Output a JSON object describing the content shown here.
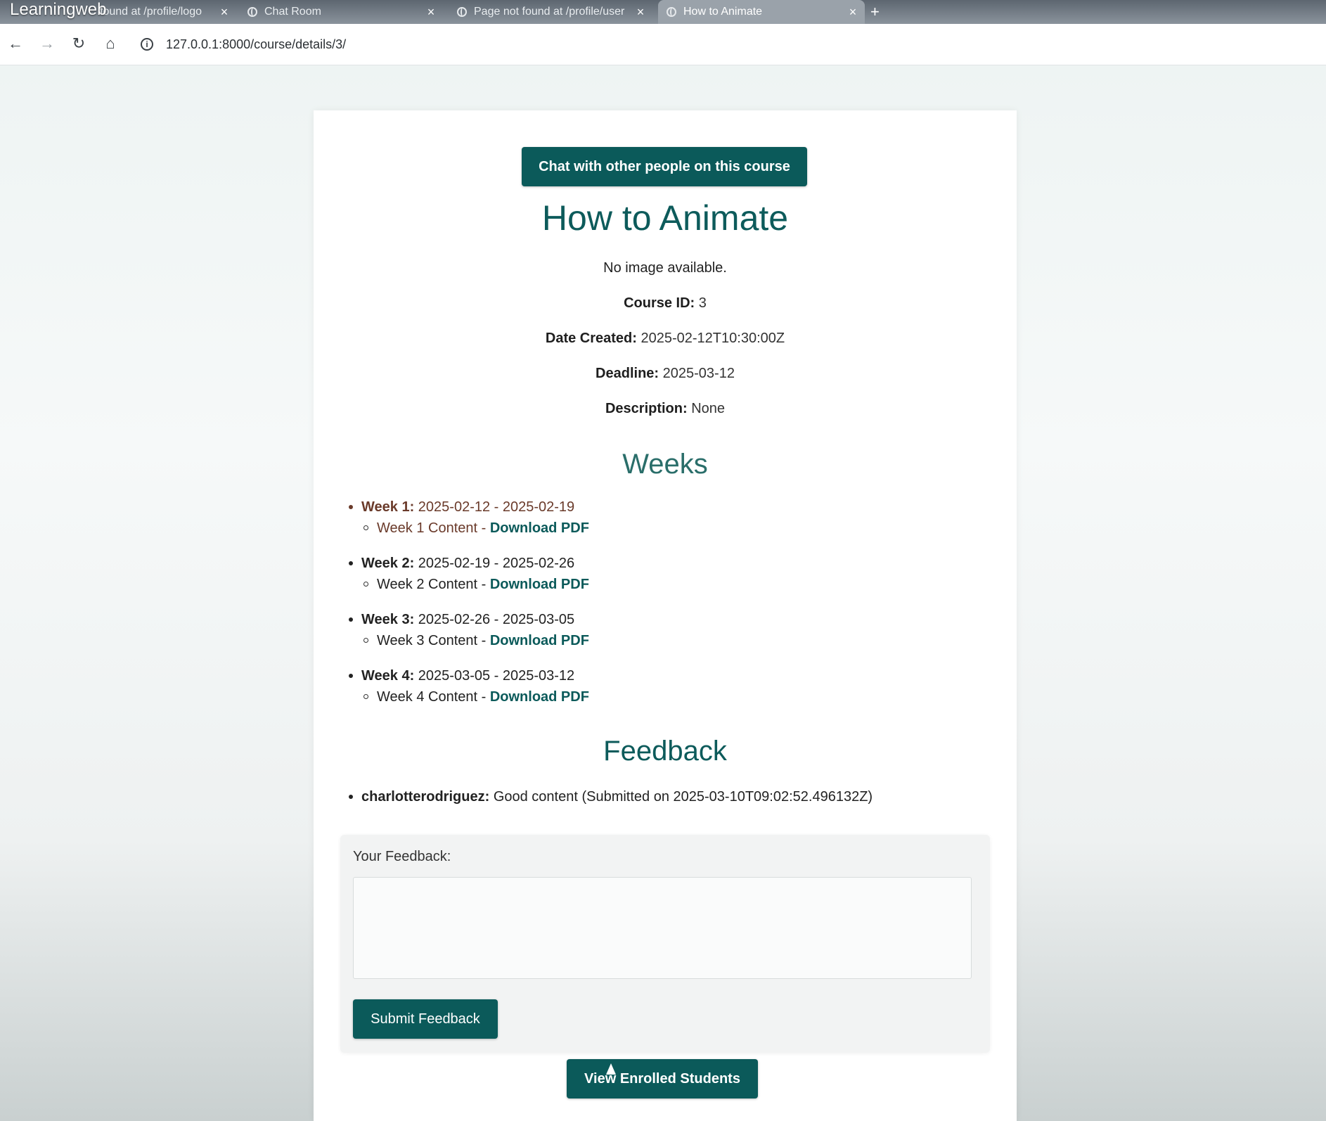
{
  "browser": {
    "brand": "Learningweb",
    "tabs": [
      {
        "title": "found at /profile/logo",
        "close": "×"
      },
      {
        "title": "Chat Room",
        "close": "×"
      },
      {
        "title": "Page not found at /profile/user",
        "close": "×"
      },
      {
        "title": "How to Animate",
        "close": "×"
      }
    ],
    "new_tab": "+",
    "url": "127.0.0.1:8000/course/details/3/",
    "nav": {
      "back": "←",
      "forward": "→",
      "reload": "↻",
      "home": "⌂",
      "info": "i"
    }
  },
  "course": {
    "chat_button": "Chat with other people on this course",
    "title": "How to Animate",
    "image_note": "No image available.",
    "course_id_label": "Course ID:",
    "course_id": "3",
    "date_created_label": "Date Created:",
    "date_created": "2025-02-12T10:30:00Z",
    "deadline_label": "Deadline:",
    "deadline": "2025-03-12",
    "description_label": "Description:",
    "description": "None"
  },
  "weeks": {
    "heading": "Weeks",
    "items": [
      {
        "label": "Week 1:",
        "range": "2025-02-12 - 2025-02-19",
        "content": "Week 1 Content - ",
        "link": "Download PDF"
      },
      {
        "label": "Week 2:",
        "range": "2025-02-19 - 2025-02-26",
        "content": "Week 2 Content - ",
        "link": "Download PDF"
      },
      {
        "label": "Week 3:",
        "range": "2025-02-26 - 2025-03-05",
        "content": "Week 3 Content - ",
        "link": "Download PDF"
      },
      {
        "label": "Week 4:",
        "range": "2025-03-05 - 2025-03-12",
        "content": "Week 4 Content - ",
        "link": "Download PDF"
      }
    ]
  },
  "feedback": {
    "heading": "Feedback",
    "items": [
      {
        "user": "charlotterodriguez:",
        "text": "Good content (Submitted on 2025-03-10T09:02:52.496132Z)"
      }
    ],
    "form_label": "Your Feedback:",
    "textarea_value": "",
    "submit_label": "Submit Feedback"
  },
  "enrolled_button": "View Enrolled Students",
  "colors": {
    "accent": "#0b5a5a",
    "title": "#0d5b5b"
  }
}
